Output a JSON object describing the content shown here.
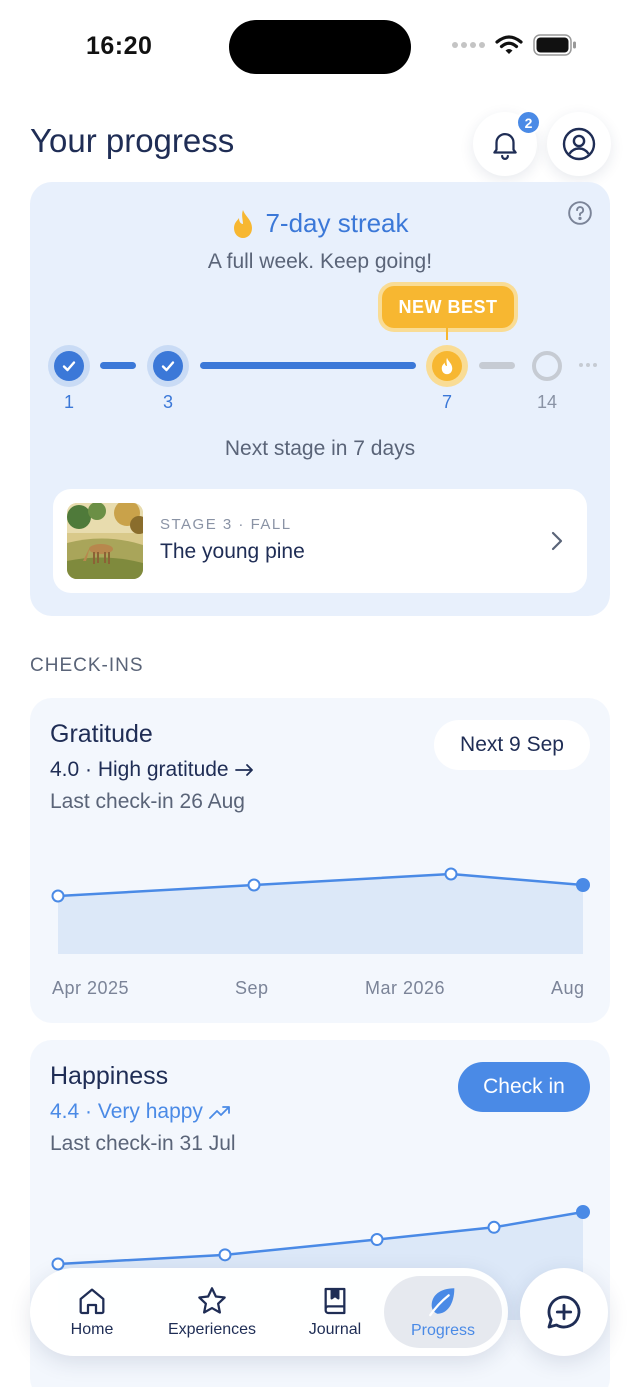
{
  "status_bar": {
    "time": "16:20"
  },
  "header": {
    "title": "Your progress",
    "notification_count": "2"
  },
  "streak": {
    "title": "7-day streak",
    "subtitle": "A full week. Keep going!",
    "badge": "NEW BEST",
    "milestones": [
      {
        "label": "1",
        "state": "done"
      },
      {
        "label": "3",
        "state": "done"
      },
      {
        "label": "7",
        "state": "current"
      },
      {
        "label": "14",
        "state": "future"
      }
    ],
    "next_stage": "Next stage in 7 days",
    "stage": {
      "label": "STAGE 3 · FALL",
      "name": "The young pine"
    },
    "colors": {
      "accent": "#3b78d8",
      "fire": "#f7b731"
    }
  },
  "checkins": {
    "section_label": "CHECK-INS",
    "gratitude": {
      "title": "Gratitude",
      "score": "4.0 · High gratitude",
      "trend_icon": "arrow-right-icon",
      "last": "Last check-in 26 Aug",
      "action": "Next 9 Sep",
      "x_labels": [
        "Apr 2025",
        "Sep",
        "Mar 2026",
        "Aug"
      ],
      "values": [
        3.6,
        3.75,
        3.9,
        3.75
      ]
    },
    "happiness": {
      "title": "Happiness",
      "score": "4.4 · Very happy",
      "trend_icon": "trend-up-icon",
      "last": "Last check-in 31 Jul",
      "action": "Check in",
      "values": [
        3.3,
        3.45,
        3.7,
        3.9,
        4.15
      ]
    }
  },
  "tabs": [
    {
      "label": "Home",
      "icon": "home-icon"
    },
    {
      "label": "Experiences",
      "icon": "star-icon"
    },
    {
      "label": "Journal",
      "icon": "journal-icon"
    },
    {
      "label": "Progress",
      "icon": "leaf-icon",
      "active": true
    }
  ]
}
